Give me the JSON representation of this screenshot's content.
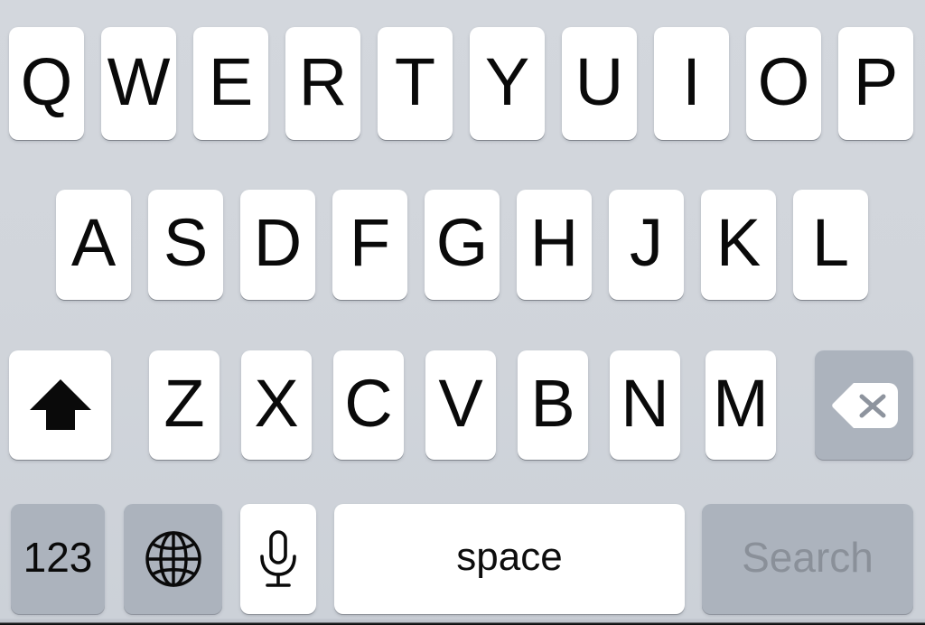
{
  "keyboard": {
    "name": "ios-qwerty-keyboard",
    "layout": "QWERTY",
    "case": "uppercase",
    "background_color": "#d1d5db",
    "key_light_color": "#ffffff",
    "key_dark_color": "#acb3bd",
    "key_text_color": "#0a0a0a",
    "disabled_text_color": "#8a9099",
    "rows": [
      {
        "name": "row-1",
        "keys": [
          {
            "label": "Q",
            "type": "letter",
            "style": "light"
          },
          {
            "label": "W",
            "type": "letter",
            "style": "light"
          },
          {
            "label": "E",
            "type": "letter",
            "style": "light"
          },
          {
            "label": "R",
            "type": "letter",
            "style": "light"
          },
          {
            "label": "T",
            "type": "letter",
            "style": "light"
          },
          {
            "label": "Y",
            "type": "letter",
            "style": "light"
          },
          {
            "label": "U",
            "type": "letter",
            "style": "light"
          },
          {
            "label": "I",
            "type": "letter",
            "style": "light"
          },
          {
            "label": "O",
            "type": "letter",
            "style": "light"
          },
          {
            "label": "P",
            "type": "letter",
            "style": "light"
          }
        ]
      },
      {
        "name": "row-2",
        "keys": [
          {
            "label": "A",
            "type": "letter",
            "style": "light"
          },
          {
            "label": "S",
            "type": "letter",
            "style": "light"
          },
          {
            "label": "D",
            "type": "letter",
            "style": "light"
          },
          {
            "label": "F",
            "type": "letter",
            "style": "light"
          },
          {
            "label": "G",
            "type": "letter",
            "style": "light"
          },
          {
            "label": "H",
            "type": "letter",
            "style": "light"
          },
          {
            "label": "J",
            "type": "letter",
            "style": "light"
          },
          {
            "label": "K",
            "type": "letter",
            "style": "light"
          },
          {
            "label": "L",
            "type": "letter",
            "style": "light"
          }
        ]
      },
      {
        "name": "row-3",
        "keys": [
          {
            "label": "",
            "type": "shift",
            "icon": "shift-arrow-icon",
            "style": "light"
          },
          {
            "label": "Z",
            "type": "letter",
            "style": "light"
          },
          {
            "label": "X",
            "type": "letter",
            "style": "light"
          },
          {
            "label": "C",
            "type": "letter",
            "style": "light"
          },
          {
            "label": "V",
            "type": "letter",
            "style": "light"
          },
          {
            "label": "B",
            "type": "letter",
            "style": "light"
          },
          {
            "label": "N",
            "type": "letter",
            "style": "light"
          },
          {
            "label": "M",
            "type": "letter",
            "style": "light"
          },
          {
            "label": "",
            "type": "backspace",
            "icon": "backspace-delete-icon",
            "style": "dark"
          }
        ]
      },
      {
        "name": "row-4",
        "keys": [
          {
            "label": "123",
            "type": "numeric-mode",
            "style": "dark"
          },
          {
            "label": "",
            "type": "globe",
            "icon": "globe-icon",
            "style": "dark"
          },
          {
            "label": "",
            "type": "dictation",
            "icon": "microphone-icon",
            "style": "light"
          },
          {
            "label": "space",
            "type": "space",
            "style": "light"
          },
          {
            "label": "Search",
            "type": "return",
            "style": "dark",
            "state": "disabled"
          }
        ]
      }
    ]
  }
}
